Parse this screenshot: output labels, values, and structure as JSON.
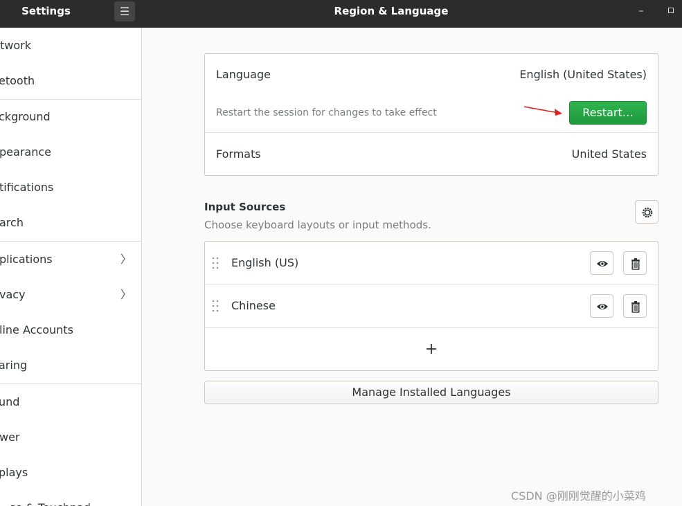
{
  "window": {
    "app_title": "Settings",
    "page_title": "Region & Language",
    "minimize_glyph": "–"
  },
  "sidebar": {
    "items": [
      {
        "label": "twork"
      },
      {
        "label": "etooth"
      },
      {
        "label": "ckground"
      },
      {
        "label": "pearance"
      },
      {
        "label": "tifications"
      },
      {
        "label": "arch"
      },
      {
        "label": "plications",
        "chevron": "〉"
      },
      {
        "label": "vacy",
        "chevron": "〉"
      },
      {
        "label": "line Accounts"
      },
      {
        "label": "aring"
      },
      {
        "label": "und"
      },
      {
        "label": "wer"
      },
      {
        "label": "plays"
      },
      {
        "label": "se & Touchpad"
      }
    ]
  },
  "language_section": {
    "language_label": "Language",
    "language_value": "English (United States)",
    "restart_hint": "Restart the session for changes to take effect",
    "restart_button": "Restart…",
    "formats_label": "Formats",
    "formats_value": "United States"
  },
  "input_sources": {
    "title": "Input Sources",
    "subtitle": "Choose keyboard layouts or input methods.",
    "sources": [
      {
        "name": "English (US)"
      },
      {
        "name": "Chinese"
      }
    ],
    "add_glyph": "+"
  },
  "manage_button": "Manage Installed Languages",
  "watermark": "CSDN @刚刚觉醒的小菜鸡",
  "colors": {
    "header_bg": "#2c2c2c",
    "restart_green": "#1e9a3c",
    "annotation_arrow": "#e02020"
  },
  "icons": [
    "hamburger-menu-icon",
    "gear-icon",
    "eye-icon",
    "trash-icon",
    "drag-handle-icon"
  ]
}
